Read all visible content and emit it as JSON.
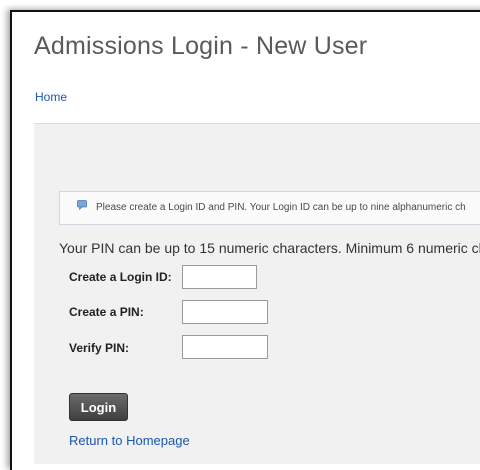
{
  "page": {
    "title": "Admissions Login - New User",
    "breadcrumb_home": "Home"
  },
  "info": {
    "icon": "info-icon",
    "message": "Please create a Login ID and PIN. Your Login ID can be up to nine alphanumeric ch"
  },
  "pin_rule": "Your PIN can be up to 15 numeric characters. Minimum 6 numeric ch",
  "form": {
    "login_id_label": "Create a Login ID:",
    "login_id_value": "",
    "pin_label": "Create a PIN:",
    "pin_value": "",
    "verify_pin_label": "Verify PIN:",
    "verify_pin_value": "",
    "submit_label": "Login"
  },
  "footer": {
    "return_link": "Return to Homepage"
  },
  "colors": {
    "link": "#1a56b0",
    "panel_bg": "#f1f1f1",
    "button_bg": "#4f4f4f"
  }
}
